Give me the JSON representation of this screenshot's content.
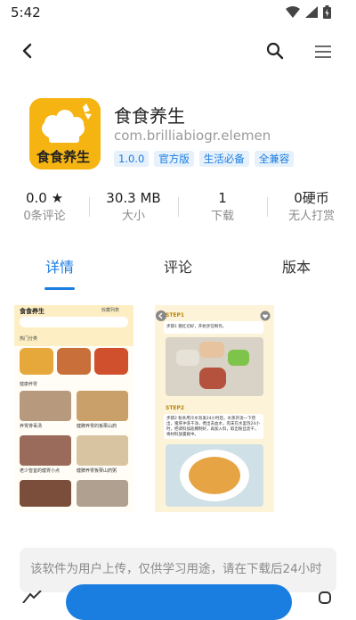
{
  "status_bar": {
    "time": "5:42"
  },
  "app": {
    "name": "食食养生",
    "package": "com.brilliabiogr.elemen",
    "icon_text": "食食养生",
    "tags": [
      "1.0.0",
      "官方版",
      "生活必备",
      "全兼容"
    ]
  },
  "stats": [
    {
      "value": "0.0 ★",
      "label": "0条评论"
    },
    {
      "value": "30.3 MB",
      "label": "大小"
    },
    {
      "value": "1",
      "label": "下载"
    },
    {
      "value": "0硬币",
      "label": "无人打赏"
    }
  ],
  "tabs": [
    "详情",
    "评论",
    "版本"
  ],
  "screenshot1": {
    "title": "食食养生",
    "fav": "收藏列表",
    "section1": "热门分类",
    "section2": "健康养胃",
    "items": [
      "养胃排毒汤",
      "健脾养胃的板栗山药",
      "老少皆宜的健胃小点",
      "健脾养胃板栗山药粥"
    ]
  },
  "screenshot2": {
    "step1": "STEP1",
    "step1_text": "步骤1 猪红切好，开始烹饪制作。",
    "step2": "STEP2",
    "step2_text": "步骤2 粉条用冷水泡发24小时后，水蒸开烫一下捞出，猪肝冲洗干净，煮出去血水，肉末在水里泡24小时，把调料加盐腌制好，再加入料，取出粉丝沥干，将材料放置碗中。"
  },
  "notice": "该软件为用户上传，仅供学习用途，请在下载后24小时"
}
